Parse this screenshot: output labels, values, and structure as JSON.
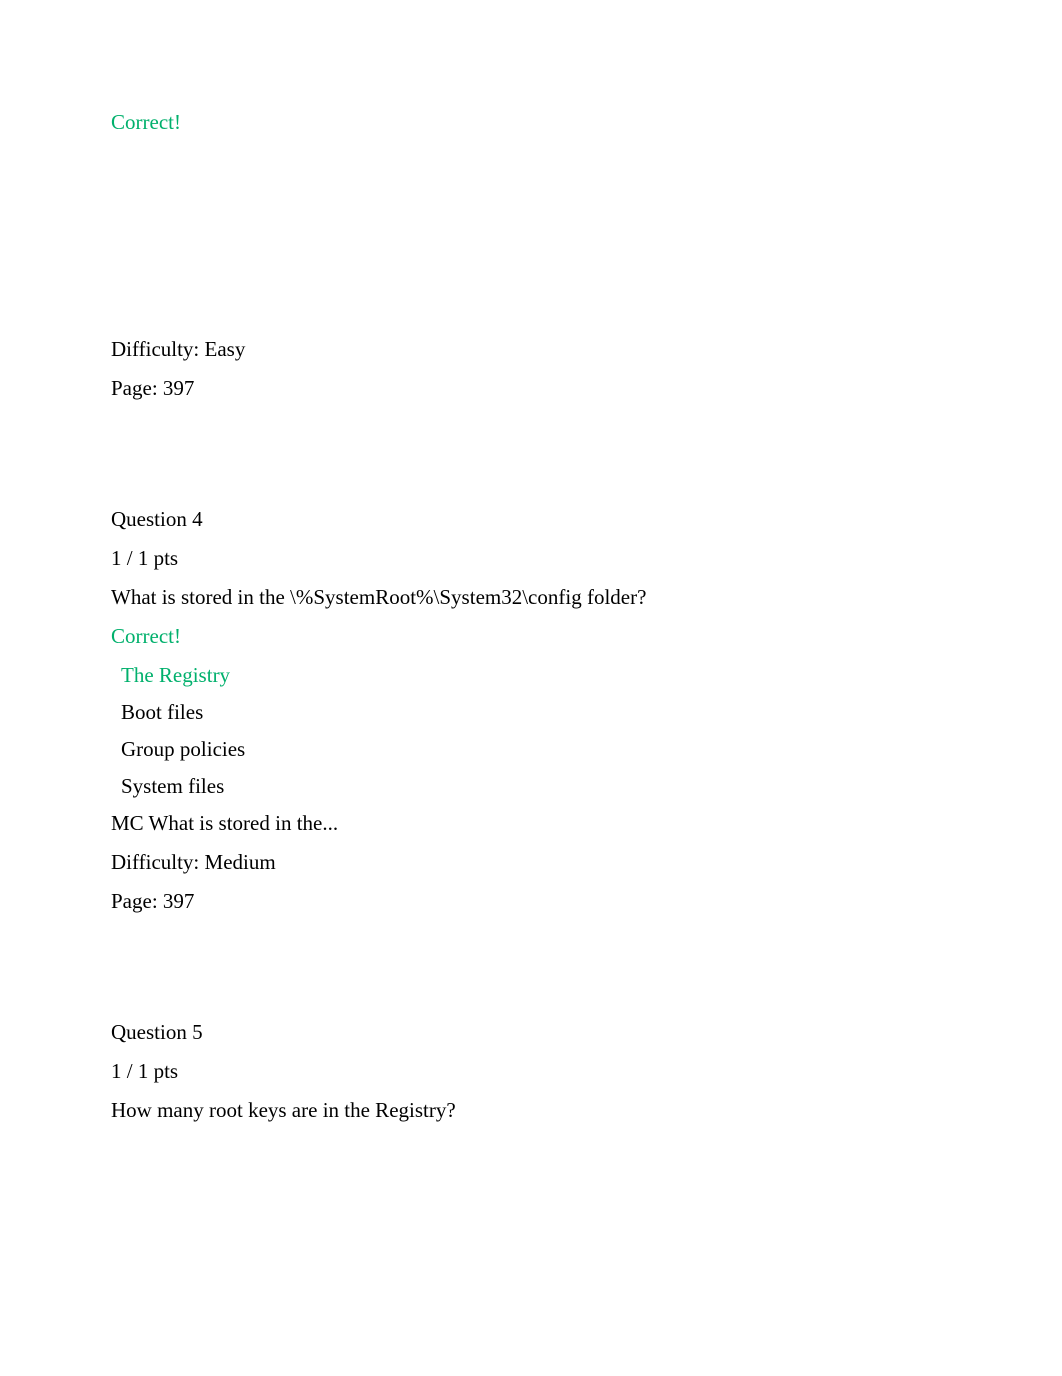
{
  "q3": {
    "correct_label": "Correct!",
    "difficulty": "Difficulty: Easy",
    "page": "Page: 397"
  },
  "q4": {
    "header": "Question 4",
    "points": "1 / 1 pts",
    "question": "What is stored in the \\%SystemRoot%\\System32\\config folder?",
    "correct_label": "Correct!",
    "options": [
      "The Registry",
      "Boot files",
      "Group policies",
      "System files"
    ],
    "meta_line": "MC What is stored in the...",
    "difficulty": "Difficulty: Medium",
    "page": "Page: 397"
  },
  "q5": {
    "header": "Question 5",
    "points": "1 / 1 pts",
    "question": "How many root keys are in the Registry?"
  }
}
